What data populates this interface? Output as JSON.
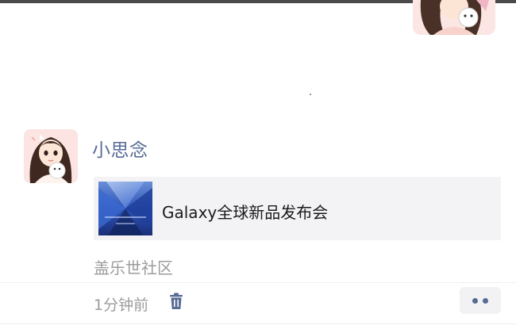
{
  "post": {
    "author_name": "小思念",
    "link": {
      "title": "Galaxy全球新品发布会",
      "thumb_icon": "galaxy-launch-thumbnail"
    },
    "source": "盖乐世社区",
    "time": "1分钟前",
    "delete_icon": "trash-icon",
    "more_icon": "two-dots-icon"
  },
  "colors": {
    "name_link": "#576b95",
    "meta_gray": "#9c9c9c",
    "card_bg": "#f3f3f5"
  }
}
